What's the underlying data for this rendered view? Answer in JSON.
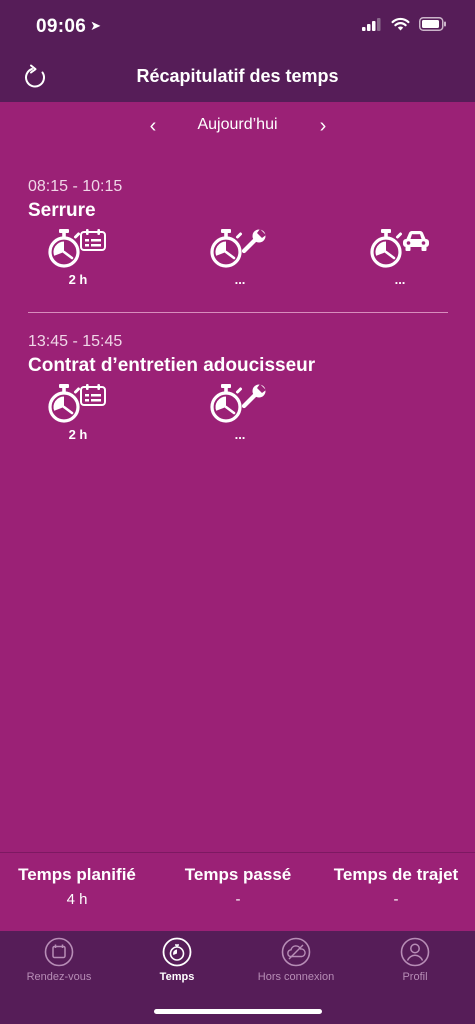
{
  "status_bar": {
    "time": "09:06"
  },
  "header": {
    "title": "Récapitulatif des temps"
  },
  "date_nav": {
    "label": "Aujourd’hui",
    "prev": "‹",
    "next": "›"
  },
  "appointments": [
    {
      "time": "08:15 - 10:15",
      "title": "Serrure",
      "planned": "2 h",
      "spent": "...",
      "travel": "..."
    },
    {
      "time": "13:45 - 15:45",
      "title": "Contrat d’entretien adoucisseur",
      "planned": "2 h",
      "spent": "..."
    }
  ],
  "summary": {
    "planned_label": "Temps planifié",
    "planned_value": "4 h",
    "spent_label": "Temps passé",
    "spent_value": "-",
    "travel_label": "Temps de trajet",
    "travel_value": "-"
  },
  "tabs": [
    {
      "label": "Rendez-vous",
      "icon": "calendar-icon"
    },
    {
      "label": "Temps",
      "icon": "stopwatch-icon",
      "active": true
    },
    {
      "label": "Hors connexion",
      "icon": "cloud-offline-icon"
    },
    {
      "label": "Profil",
      "icon": "profile-icon"
    }
  ],
  "colors": {
    "background": "#9b2176",
    "bar": "#561d58",
    "inactive_tab": "#b78db6"
  }
}
